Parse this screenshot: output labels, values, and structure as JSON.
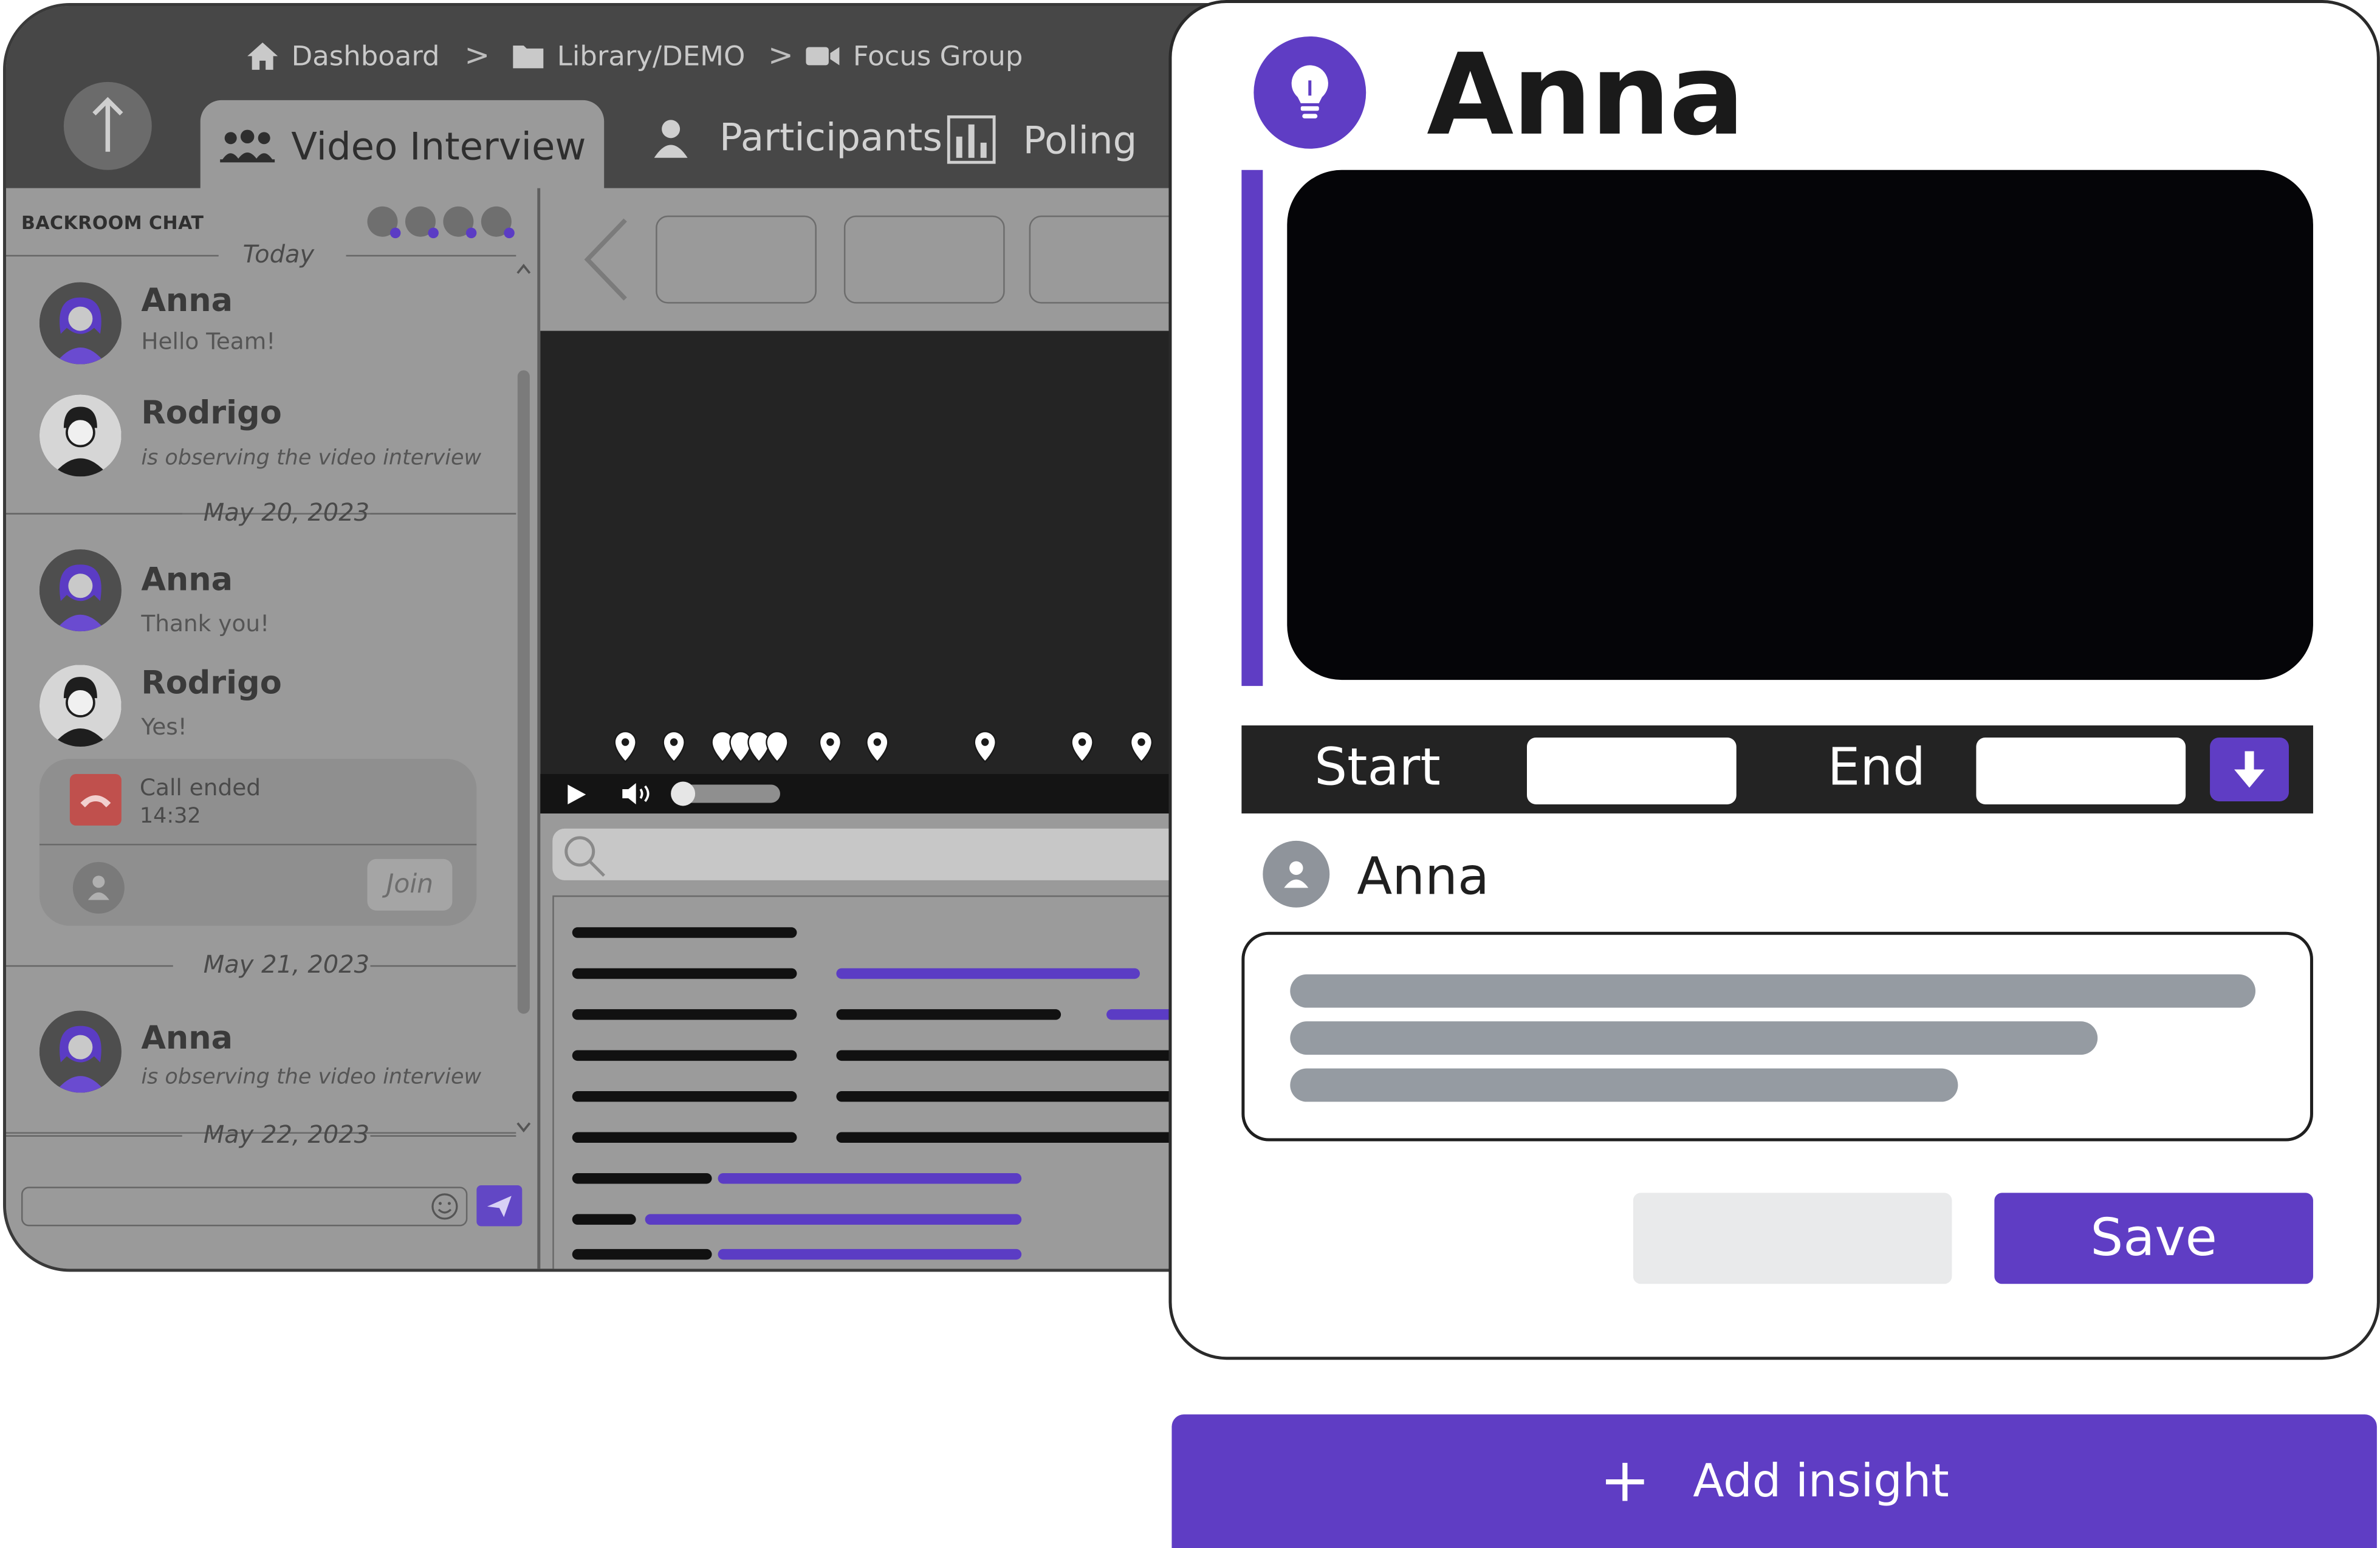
{
  "breadcrumb": {
    "items": [
      {
        "label": "Dashboard",
        "icon": "home-icon"
      },
      {
        "label": "Library/DEMO",
        "icon": "folder-icon"
      },
      {
        "label": "Focus Group",
        "icon": "camera-icon"
      }
    ],
    "separator": ">"
  },
  "tabs": [
    {
      "label": "Video Interview",
      "icon": "group-icon",
      "active": true
    },
    {
      "label": "Participants",
      "icon": "user-icon",
      "active": false
    },
    {
      "label": "Poling",
      "icon": "bar-chart-icon",
      "active": false
    }
  ],
  "chat": {
    "title": "BACKROOM CHAT",
    "dates": [
      "Today",
      "May 20, 2023",
      "May 21, 2023",
      "May 22, 2023"
    ],
    "messages": [
      {
        "name": "Anna",
        "text": "Hello Team!"
      },
      {
        "name": "Rodrigo",
        "text": "is observing the video interview"
      },
      {
        "name": "Anna",
        "text": "Thank you!"
      },
      {
        "name": "Rodrigo",
        "text": "Yes!"
      },
      {
        "name": "Anna",
        "text": "is observing the video interview"
      }
    ],
    "call": {
      "status": "Call ended",
      "time": "14:32",
      "join_label": "Join"
    }
  },
  "insight": {
    "title": "Anna",
    "range": {
      "start_label": "Start",
      "end_label": "End"
    },
    "author": "Anna",
    "save_label": "Save"
  },
  "add_insight_label": "Add insight",
  "colors": {
    "accent": "#5f3dc4",
    "dark": "#232323",
    "dim": "#9a9a9a"
  }
}
